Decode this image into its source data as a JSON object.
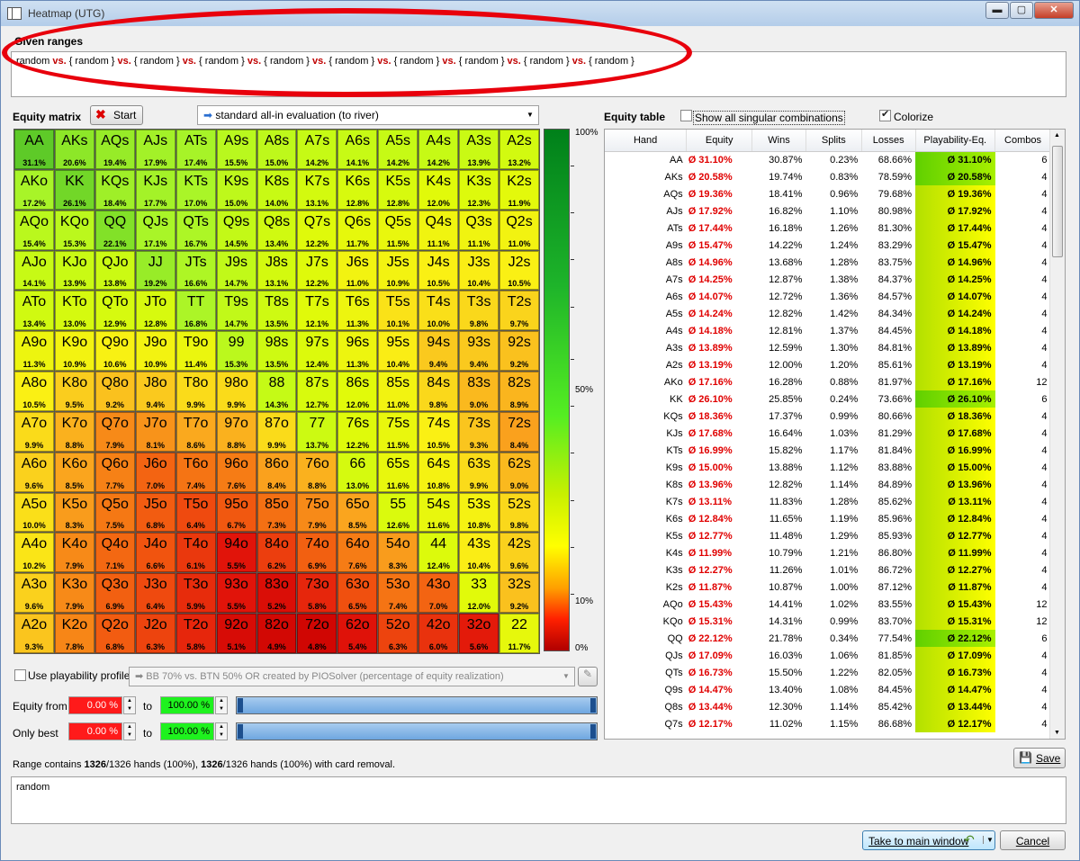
{
  "window": {
    "title": "Heatmap (UTG)",
    "minimize": "▬",
    "maximize": "▢",
    "close": "✕"
  },
  "given_ranges": {
    "label": "Given ranges",
    "first": "random",
    "vs": "vs.",
    "items": [
      "{ random }",
      "{ random }",
      "{ random }",
      "{ random }",
      "{ random }",
      "{ random }",
      "{ random }",
      "{ random }",
      "{ random }"
    ]
  },
  "equity_matrix": {
    "label": "Equity matrix",
    "start_button": "Start",
    "evaluation_mode": "standard all-in evaluation (to river)",
    "cells": [
      [
        [
          "AA",
          "31.1%"
        ],
        [
          "AKs",
          "20.6%"
        ],
        [
          "AQs",
          "19.4%"
        ],
        [
          "AJs",
          "17.9%"
        ],
        [
          "ATs",
          "17.4%"
        ],
        [
          "A9s",
          "15.5%"
        ],
        [
          "A8s",
          "15.0%"
        ],
        [
          "A7s",
          "14.2%"
        ],
        [
          "A6s",
          "14.1%"
        ],
        [
          "A5s",
          "14.2%"
        ],
        [
          "A4s",
          "14.2%"
        ],
        [
          "A3s",
          "13.9%"
        ],
        [
          "A2s",
          "13.2%"
        ]
      ],
      [
        [
          "AKo",
          "17.2%"
        ],
        [
          "KK",
          "26.1%"
        ],
        [
          "KQs",
          "18.4%"
        ],
        [
          "KJs",
          "17.7%"
        ],
        [
          "KTs",
          "17.0%"
        ],
        [
          "K9s",
          "15.0%"
        ],
        [
          "K8s",
          "14.0%"
        ],
        [
          "K7s",
          "13.1%"
        ],
        [
          "K6s",
          "12.8%"
        ],
        [
          "K5s",
          "12.8%"
        ],
        [
          "K4s",
          "12.0%"
        ],
        [
          "K3s",
          "12.3%"
        ],
        [
          "K2s",
          "11.9%"
        ]
      ],
      [
        [
          "AQo",
          "15.4%"
        ],
        [
          "KQo",
          "15.3%"
        ],
        [
          "QQ",
          "22.1%"
        ],
        [
          "QJs",
          "17.1%"
        ],
        [
          "QTs",
          "16.7%"
        ],
        [
          "Q9s",
          "14.5%"
        ],
        [
          "Q8s",
          "13.4%"
        ],
        [
          "Q7s",
          "12.2%"
        ],
        [
          "Q6s",
          "11.7%"
        ],
        [
          "Q5s",
          "11.5%"
        ],
        [
          "Q4s",
          "11.1%"
        ],
        [
          "Q3s",
          "11.1%"
        ],
        [
          "Q2s",
          "11.0%"
        ]
      ],
      [
        [
          "AJo",
          "14.1%"
        ],
        [
          "KJo",
          "13.9%"
        ],
        [
          "QJo",
          "13.8%"
        ],
        [
          "JJ",
          "19.2%"
        ],
        [
          "JTs",
          "16.6%"
        ],
        [
          "J9s",
          "14.7%"
        ],
        [
          "J8s",
          "13.1%"
        ],
        [
          "J7s",
          "12.2%"
        ],
        [
          "J6s",
          "11.0%"
        ],
        [
          "J5s",
          "10.9%"
        ],
        [
          "J4s",
          "10.5%"
        ],
        [
          "J3s",
          "10.4%"
        ],
        [
          "J2s",
          "10.5%"
        ]
      ],
      [
        [
          "ATo",
          "13.4%"
        ],
        [
          "KTo",
          "13.0%"
        ],
        [
          "QTo",
          "12.9%"
        ],
        [
          "JTo",
          "12.8%"
        ],
        [
          "TT",
          "16.8%"
        ],
        [
          "T9s",
          "14.7%"
        ],
        [
          "T8s",
          "13.5%"
        ],
        [
          "T7s",
          "12.1%"
        ],
        [
          "T6s",
          "11.3%"
        ],
        [
          "T5s",
          "10.1%"
        ],
        [
          "T4s",
          "10.0%"
        ],
        [
          "T3s",
          "9.8%"
        ],
        [
          "T2s",
          "9.7%"
        ]
      ],
      [
        [
          "A9o",
          "11.3%"
        ],
        [
          "K9o",
          "10.9%"
        ],
        [
          "Q9o",
          "10.6%"
        ],
        [
          "J9o",
          "10.9%"
        ],
        [
          "T9o",
          "11.4%"
        ],
        [
          "99",
          "15.3%"
        ],
        [
          "98s",
          "13.5%"
        ],
        [
          "97s",
          "12.4%"
        ],
        [
          "96s",
          "11.3%"
        ],
        [
          "95s",
          "10.4%"
        ],
        [
          "94s",
          "9.4%"
        ],
        [
          "93s",
          "9.4%"
        ],
        [
          "92s",
          "9.2%"
        ]
      ],
      [
        [
          "A8o",
          "10.5%"
        ],
        [
          "K8o",
          "9.5%"
        ],
        [
          "Q8o",
          "9.2%"
        ],
        [
          "J8o",
          "9.4%"
        ],
        [
          "T8o",
          "9.9%"
        ],
        [
          "98o",
          "9.9%"
        ],
        [
          "88",
          "14.3%"
        ],
        [
          "87s",
          "12.7%"
        ],
        [
          "86s",
          "12.0%"
        ],
        [
          "85s",
          "11.0%"
        ],
        [
          "84s",
          "9.8%"
        ],
        [
          "83s",
          "9.0%"
        ],
        [
          "82s",
          "8.9%"
        ]
      ],
      [
        [
          "A7o",
          "9.9%"
        ],
        [
          "K7o",
          "8.8%"
        ],
        [
          "Q7o",
          "7.9%"
        ],
        [
          "J7o",
          "8.1%"
        ],
        [
          "T7o",
          "8.6%"
        ],
        [
          "97o",
          "8.8%"
        ],
        [
          "87o",
          "9.9%"
        ],
        [
          "77",
          "13.7%"
        ],
        [
          "76s",
          "12.2%"
        ],
        [
          "75s",
          "11.5%"
        ],
        [
          "74s",
          "10.5%"
        ],
        [
          "73s",
          "9.3%"
        ],
        [
          "72s",
          "8.4%"
        ]
      ],
      [
        [
          "A6o",
          "9.6%"
        ],
        [
          "K6o",
          "8.5%"
        ],
        [
          "Q6o",
          "7.7%"
        ],
        [
          "J6o",
          "7.0%"
        ],
        [
          "T6o",
          "7.4%"
        ],
        [
          "96o",
          "7.6%"
        ],
        [
          "86o",
          "8.4%"
        ],
        [
          "76o",
          "8.8%"
        ],
        [
          "66",
          "13.0%"
        ],
        [
          "65s",
          "11.6%"
        ],
        [
          "64s",
          "10.8%"
        ],
        [
          "63s",
          "9.9%"
        ],
        [
          "62s",
          "9.0%"
        ]
      ],
      [
        [
          "A5o",
          "10.0%"
        ],
        [
          "K5o",
          "8.3%"
        ],
        [
          "Q5o",
          "7.5%"
        ],
        [
          "J5o",
          "6.8%"
        ],
        [
          "T5o",
          "6.4%"
        ],
        [
          "95o",
          "6.7%"
        ],
        [
          "85o",
          "7.3%"
        ],
        [
          "75o",
          "7.9%"
        ],
        [
          "65o",
          "8.5%"
        ],
        [
          "55",
          "12.6%"
        ],
        [
          "54s",
          "11.6%"
        ],
        [
          "53s",
          "10.8%"
        ],
        [
          "52s",
          "9.8%"
        ]
      ],
      [
        [
          "A4o",
          "10.2%"
        ],
        [
          "K4o",
          "7.9%"
        ],
        [
          "Q4o",
          "7.1%"
        ],
        [
          "J4o",
          "6.6%"
        ],
        [
          "T4o",
          "6.1%"
        ],
        [
          "94o",
          "5.5%"
        ],
        [
          "84o",
          "6.2%"
        ],
        [
          "74o",
          "6.9%"
        ],
        [
          "64o",
          "7.6%"
        ],
        [
          "54o",
          "8.3%"
        ],
        [
          "44",
          "12.4%"
        ],
        [
          "43s",
          "10.4%"
        ],
        [
          "42s",
          "9.6%"
        ]
      ],
      [
        [
          "A3o",
          "9.6%"
        ],
        [
          "K3o",
          "7.9%"
        ],
        [
          "Q3o",
          "6.9%"
        ],
        [
          "J3o",
          "6.4%"
        ],
        [
          "T3o",
          "5.9%"
        ],
        [
          "93o",
          "5.5%"
        ],
        [
          "83o",
          "5.2%"
        ],
        [
          "73o",
          "5.8%"
        ],
        [
          "63o",
          "6.5%"
        ],
        [
          "53o",
          "7.4%"
        ],
        [
          "43o",
          "7.0%"
        ],
        [
          "33",
          "12.0%"
        ],
        [
          "32s",
          "9.2%"
        ]
      ],
      [
        [
          "A2o",
          "9.3%"
        ],
        [
          "K2o",
          "7.8%"
        ],
        [
          "Q2o",
          "6.8%"
        ],
        [
          "J2o",
          "6.3%"
        ],
        [
          "T2o",
          "5.8%"
        ],
        [
          "92o",
          "5.1%"
        ],
        [
          "82o",
          "4.9%"
        ],
        [
          "72o",
          "4.8%"
        ],
        [
          "62o",
          "5.4%"
        ],
        [
          "52o",
          "6.3%"
        ],
        [
          "42o",
          "6.0%"
        ],
        [
          "32o",
          "5.6%"
        ],
        [
          "22",
          "11.7%"
        ]
      ]
    ],
    "scale_labels": [
      "100%",
      "50%",
      "10%",
      "0%"
    ]
  },
  "controls": {
    "use_playability_label": "Use playability profile:",
    "playability_profile": "BB 70% vs. BTN 50% OR created by PIOSolver  (percentage of equity realization)",
    "equity_from_label": "Equity from",
    "equity_from_value": "0.00 %",
    "equity_to_value": "100.00 %",
    "only_best_label": "Only best",
    "only_best_from": "0.00 %",
    "only_best_to": "100.00 %",
    "to_label": "to"
  },
  "equity_table": {
    "label": "Equity table",
    "show_all_label": "Show all singular combinations",
    "colorize_label": "Colorize",
    "columns": [
      "Hand",
      "Equity",
      "Wins",
      "Splits",
      "Losses",
      "Playability-Eq.",
      "Combos"
    ],
    "rows": [
      [
        "AA",
        "Ø 31.10%",
        "30.87%",
        "0.23%",
        "68.66%",
        "Ø 31.10%",
        "6"
      ],
      [
        "AKs",
        "Ø 20.58%",
        "19.74%",
        "0.83%",
        "78.59%",
        "Ø 20.58%",
        "4"
      ],
      [
        "AQs",
        "Ø 19.36%",
        "18.41%",
        "0.96%",
        "79.68%",
        "Ø 19.36%",
        "4"
      ],
      [
        "AJs",
        "Ø 17.92%",
        "16.82%",
        "1.10%",
        "80.98%",
        "Ø 17.92%",
        "4"
      ],
      [
        "ATs",
        "Ø 17.44%",
        "16.18%",
        "1.26%",
        "81.30%",
        "Ø 17.44%",
        "4"
      ],
      [
        "A9s",
        "Ø 15.47%",
        "14.22%",
        "1.24%",
        "83.29%",
        "Ø 15.47%",
        "4"
      ],
      [
        "A8s",
        "Ø 14.96%",
        "13.68%",
        "1.28%",
        "83.75%",
        "Ø 14.96%",
        "4"
      ],
      [
        "A7s",
        "Ø 14.25%",
        "12.87%",
        "1.38%",
        "84.37%",
        "Ø 14.25%",
        "4"
      ],
      [
        "A6s",
        "Ø 14.07%",
        "12.72%",
        "1.36%",
        "84.57%",
        "Ø 14.07%",
        "4"
      ],
      [
        "A5s",
        "Ø 14.24%",
        "12.82%",
        "1.42%",
        "84.34%",
        "Ø 14.24%",
        "4"
      ],
      [
        "A4s",
        "Ø 14.18%",
        "12.81%",
        "1.37%",
        "84.45%",
        "Ø 14.18%",
        "4"
      ],
      [
        "A3s",
        "Ø 13.89%",
        "12.59%",
        "1.30%",
        "84.81%",
        "Ø 13.89%",
        "4"
      ],
      [
        "A2s",
        "Ø 13.19%",
        "12.00%",
        "1.20%",
        "85.61%",
        "Ø 13.19%",
        "4"
      ],
      [
        "AKo",
        "Ø 17.16%",
        "16.28%",
        "0.88%",
        "81.97%",
        "Ø 17.16%",
        "12"
      ],
      [
        "KK",
        "Ø 26.10%",
        "25.85%",
        "0.24%",
        "73.66%",
        "Ø 26.10%",
        "6"
      ],
      [
        "KQs",
        "Ø 18.36%",
        "17.37%",
        "0.99%",
        "80.66%",
        "Ø 18.36%",
        "4"
      ],
      [
        "KJs",
        "Ø 17.68%",
        "16.64%",
        "1.03%",
        "81.29%",
        "Ø 17.68%",
        "4"
      ],
      [
        "KTs",
        "Ø 16.99%",
        "15.82%",
        "1.17%",
        "81.84%",
        "Ø 16.99%",
        "4"
      ],
      [
        "K9s",
        "Ø 15.00%",
        "13.88%",
        "1.12%",
        "83.88%",
        "Ø 15.00%",
        "4"
      ],
      [
        "K8s",
        "Ø 13.96%",
        "12.82%",
        "1.14%",
        "84.89%",
        "Ø 13.96%",
        "4"
      ],
      [
        "K7s",
        "Ø 13.11%",
        "11.83%",
        "1.28%",
        "85.62%",
        "Ø 13.11%",
        "4"
      ],
      [
        "K6s",
        "Ø 12.84%",
        "11.65%",
        "1.19%",
        "85.96%",
        "Ø 12.84%",
        "4"
      ],
      [
        "K5s",
        "Ø 12.77%",
        "11.48%",
        "1.29%",
        "85.93%",
        "Ø 12.77%",
        "4"
      ],
      [
        "K4s",
        "Ø 11.99%",
        "10.79%",
        "1.21%",
        "86.80%",
        "Ø 11.99%",
        "4"
      ],
      [
        "K3s",
        "Ø 12.27%",
        "11.26%",
        "1.01%",
        "86.72%",
        "Ø 12.27%",
        "4"
      ],
      [
        "K2s",
        "Ø 11.87%",
        "10.87%",
        "1.00%",
        "87.12%",
        "Ø 11.87%",
        "4"
      ],
      [
        "AQo",
        "Ø 15.43%",
        "14.41%",
        "1.02%",
        "83.55%",
        "Ø 15.43%",
        "12"
      ],
      [
        "KQo",
        "Ø 15.31%",
        "14.31%",
        "0.99%",
        "83.70%",
        "Ø 15.31%",
        "12"
      ],
      [
        "QQ",
        "Ø 22.12%",
        "21.78%",
        "0.34%",
        "77.54%",
        "Ø 22.12%",
        "6"
      ],
      [
        "QJs",
        "Ø 17.09%",
        "16.03%",
        "1.06%",
        "81.85%",
        "Ø 17.09%",
        "4"
      ],
      [
        "QTs",
        "Ø 16.73%",
        "15.50%",
        "1.22%",
        "82.05%",
        "Ø 16.73%",
        "4"
      ],
      [
        "Q9s",
        "Ø 14.47%",
        "13.40%",
        "1.08%",
        "84.45%",
        "Ø 14.47%",
        "4"
      ],
      [
        "Q8s",
        "Ø 13.44%",
        "12.30%",
        "1.14%",
        "85.42%",
        "Ø 13.44%",
        "4"
      ],
      [
        "Q7s",
        "Ø 12.17%",
        "11.02%",
        "1.15%",
        "86.68%",
        "Ø 12.17%",
        "4"
      ]
    ]
  },
  "footer": {
    "range_info_prefix": "Range contains ",
    "range_info_n1": "1326",
    "range_info_mid1": "/1326 hands (100%), ",
    "range_info_n2": "1326",
    "range_info_mid2": "/1326 hands (100%) with card removal.",
    "save_button": "Save",
    "range_text": "random",
    "take_button": "Take to main window",
    "cancel_button": "Cancel"
  },
  "colors": {
    "vs": "#c00000",
    "equity_text": "#e00000",
    "annotation_loop": "#e8000c"
  }
}
